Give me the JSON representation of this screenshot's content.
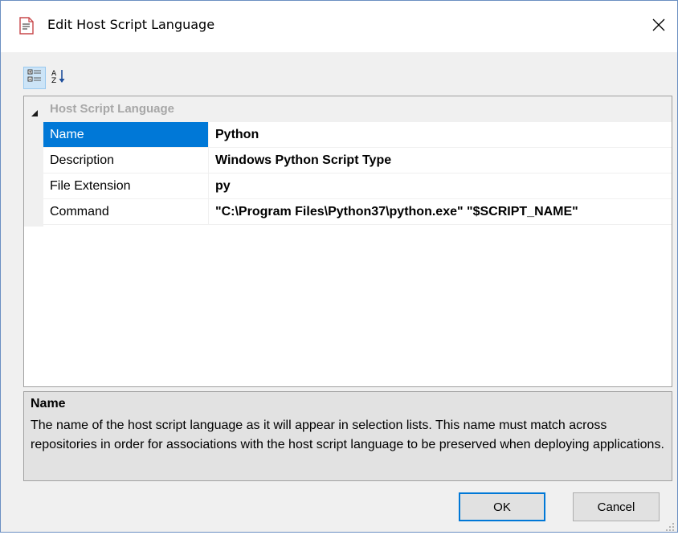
{
  "window": {
    "title": "Edit Host Script Language",
    "icon": "script-document-icon",
    "close_icon": "close-icon"
  },
  "toolbar": {
    "categorized_icon": "categorized-view-icon",
    "alphabetical_icon": "sort-alphabetical-icon",
    "categorized_pressed": true
  },
  "property_grid": {
    "category": "Host Script Language",
    "rows": [
      {
        "name": "Name",
        "value": "Python",
        "selected": true
      },
      {
        "name": "Description",
        "value": "Windows Python Script Type",
        "selected": false
      },
      {
        "name": "File Extension",
        "value": "py",
        "selected": false
      },
      {
        "name": "Command",
        "value": "\"C:\\Program Files\\Python37\\python.exe\" \"$SCRIPT_NAME\"",
        "selected": false
      }
    ]
  },
  "help": {
    "title": "Name",
    "text": "The name of the host script language as it will appear in selection lists. This name must match across repositories in order for associations with the host script language to be preserved when deploying applications."
  },
  "buttons": {
    "ok": "OK",
    "cancel": "Cancel"
  },
  "colors": {
    "selection": "#0078d7",
    "category_text": "#a7a7a7",
    "help_background": "#e2e2e2"
  }
}
